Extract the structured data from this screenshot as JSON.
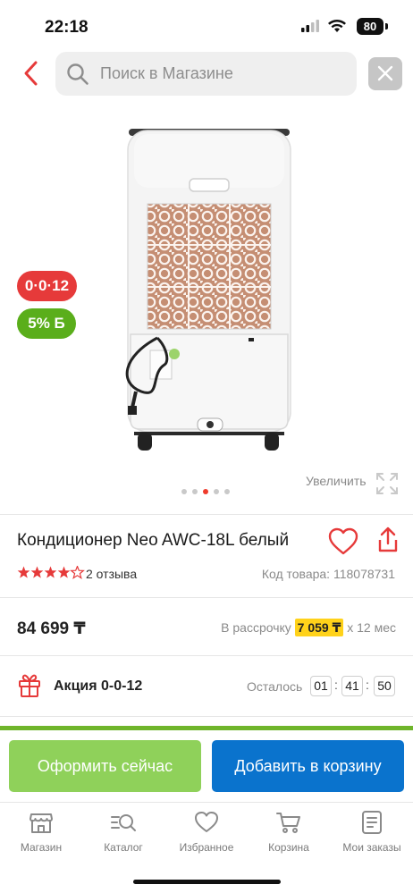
{
  "status_bar": {
    "time": "22:18",
    "battery": "80"
  },
  "header": {
    "search_placeholder": "Поиск в Магазине"
  },
  "badges": {
    "installment": "0·0·12",
    "bonus": "5% Б"
  },
  "gallery": {
    "zoom_label": "Увеличить",
    "total_images": 5,
    "active_index": 2
  },
  "product": {
    "title": "Кондиционер Neo AWC-18L белый",
    "rating": 4,
    "reviews": "2 отзыва",
    "code": "Код товара: 118078731",
    "price": "84 699 ₸",
    "installment_prefix": "В рассрочку",
    "installment_amount": "7 059 ₸",
    "installment_suffix": "х 12 мес"
  },
  "promo": {
    "label": "Акция 0-0-12",
    "remaining_label": "Осталось",
    "timer": [
      "01",
      "41",
      "50"
    ]
  },
  "actions": {
    "buy_now": "Оформить сейчас",
    "add_to_cart": "Добавить в корзину"
  },
  "tabbar": [
    {
      "label": "Магазин",
      "icon": "store-icon"
    },
    {
      "label": "Каталог",
      "icon": "catalog-search-icon"
    },
    {
      "label": "Избранное",
      "icon": "heart-icon"
    },
    {
      "label": "Корзина",
      "icon": "cart-icon"
    },
    {
      "label": "Мои заказы",
      "icon": "orders-icon"
    }
  ],
  "colors": {
    "accent_red": "#e63a3a",
    "green": "#6fb52b",
    "blue": "#0a73cd",
    "highlight": "#ffd21a"
  }
}
